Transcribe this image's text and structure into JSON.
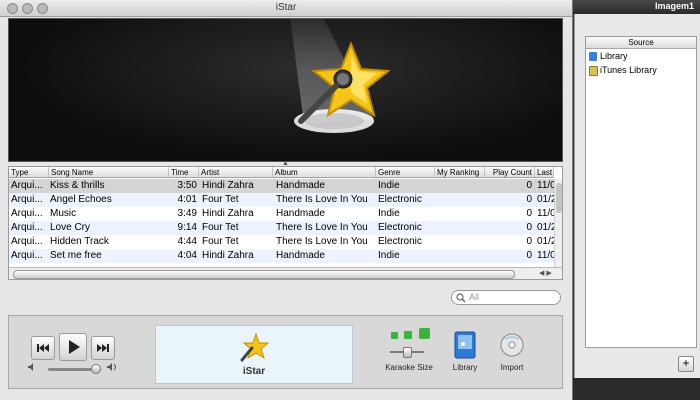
{
  "window": {
    "title": "iStar"
  },
  "secondary_window": {
    "title": "Imagem1"
  },
  "source_panel": {
    "header": "Source",
    "items": [
      {
        "label": "Library",
        "icon": "library-icon"
      },
      {
        "label": "iTunes Library",
        "icon": "itunes-library-icon"
      }
    ],
    "add_label": "+"
  },
  "track_table": {
    "columns": [
      "Type",
      "Song Name",
      "Time",
      "Artist",
      "Album",
      "Genre",
      "My Ranking",
      "Play Count",
      "Last"
    ],
    "rows": [
      {
        "type": "Arqui...",
        "song": "Kiss & thrills",
        "time": "3:50",
        "artist": "Hindi Zahra",
        "album": "Handmade",
        "genre": "Indie",
        "play_count": "0",
        "last": "11/0",
        "selected": true
      },
      {
        "type": "Arqui...",
        "song": "Angel Echoes",
        "time": "4:01",
        "artist": "Four Tet",
        "album": "There Is Love In You",
        "genre": "Electronic",
        "play_count": "0",
        "last": "01/2",
        "selected": false
      },
      {
        "type": "Arqui...",
        "song": "Music",
        "time": "3:49",
        "artist": "Hindi Zahra",
        "album": "Handmade",
        "genre": "Indie",
        "play_count": "0",
        "last": "11/0",
        "selected": false
      },
      {
        "type": "Arqui...",
        "song": "Love Cry",
        "time": "9:14",
        "artist": "Four Tet",
        "album": "There Is Love In You",
        "genre": "Electronic",
        "play_count": "0",
        "last": "01/2",
        "selected": false
      },
      {
        "type": "Arqui...",
        "song": "Hidden Track",
        "time": "4:44",
        "artist": "Four Tet",
        "album": "There Is Love In You",
        "genre": "Electronic",
        "play_count": "0",
        "last": "01/2",
        "selected": false
      },
      {
        "type": "Arqui...",
        "song": "Set me free",
        "time": "4:04",
        "artist": "Hindi Zahra",
        "album": "Handmade",
        "genre": "Indie",
        "play_count": "0",
        "last": "11/0",
        "selected": false
      }
    ]
  },
  "search": {
    "placeholder": "All"
  },
  "player": {
    "display_title": "iStar",
    "volume_level": 0.9,
    "karaoke_label": "Karaoke Size",
    "library_label": "Library",
    "import_label": "Import"
  },
  "colors": {
    "selection": "#d4d4d4",
    "alt_row": "#edf3fe",
    "display_bg": "#e9f4fb",
    "star": "#f5c518"
  }
}
